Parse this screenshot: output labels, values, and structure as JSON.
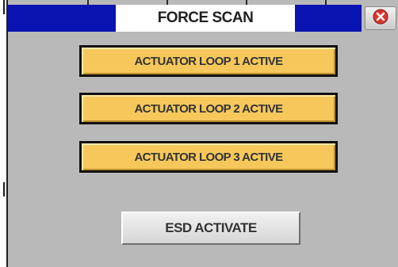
{
  "window": {
    "title": "FORCE SCAN",
    "close_icon": "close-icon",
    "colors": {
      "title_bar": "#0a14b0",
      "background": "#b9b9b9",
      "status_active": "#f6c85c",
      "close_accent": "#d8342c"
    }
  },
  "status_buttons": [
    {
      "label": "ACTUATOR LOOP 1 ACTIVE"
    },
    {
      "label": "ACTUATOR LOOP 2 ACTIVE"
    },
    {
      "label": "ACTUATOR LOOP 3 ACTIVE"
    }
  ],
  "esd": {
    "label": "ESD ACTIVATE"
  }
}
